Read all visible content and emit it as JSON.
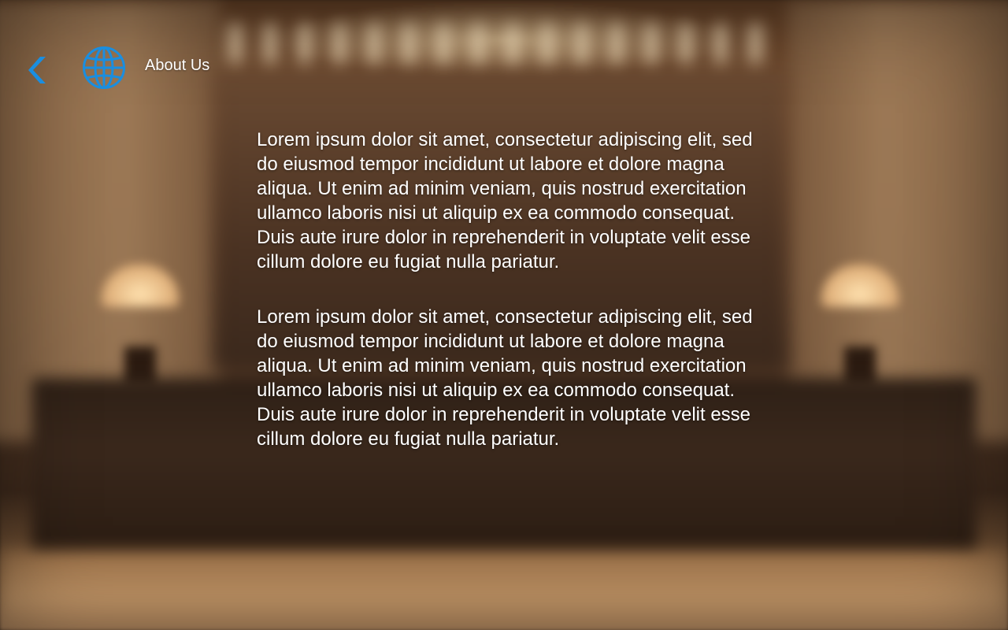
{
  "header": {
    "title": "About Us",
    "back_icon": "chevron-left-icon",
    "logo_icon": "globe-icon",
    "accent_color": "#1a8ee0"
  },
  "content": {
    "paragraphs": [
      "Lorem ipsum dolor sit amet, consectetur adipiscing elit, sed do eiusmod tempor incididunt ut labore et dolore magna aliqua. Ut enim ad minim veniam, quis nostrud exercitation ullamco laboris nisi ut aliquip ex ea commodo consequat. Duis aute irure dolor in reprehenderit in voluptate velit esse cillum dolore eu fugiat nulla pariatur.",
      "Lorem ipsum dolor sit amet, consectetur adipiscing elit, sed do eiusmod tempor incididunt ut labore et dolore magna aliqua. Ut enim ad minim veniam, quis nostrud exercitation ullamco laboris nisi ut aliquip ex ea commodo consequat. Duis aute irure dolor in reprehenderit in voluptate velit esse cillum dolore eu fugiat nulla pariatur."
    ]
  }
}
